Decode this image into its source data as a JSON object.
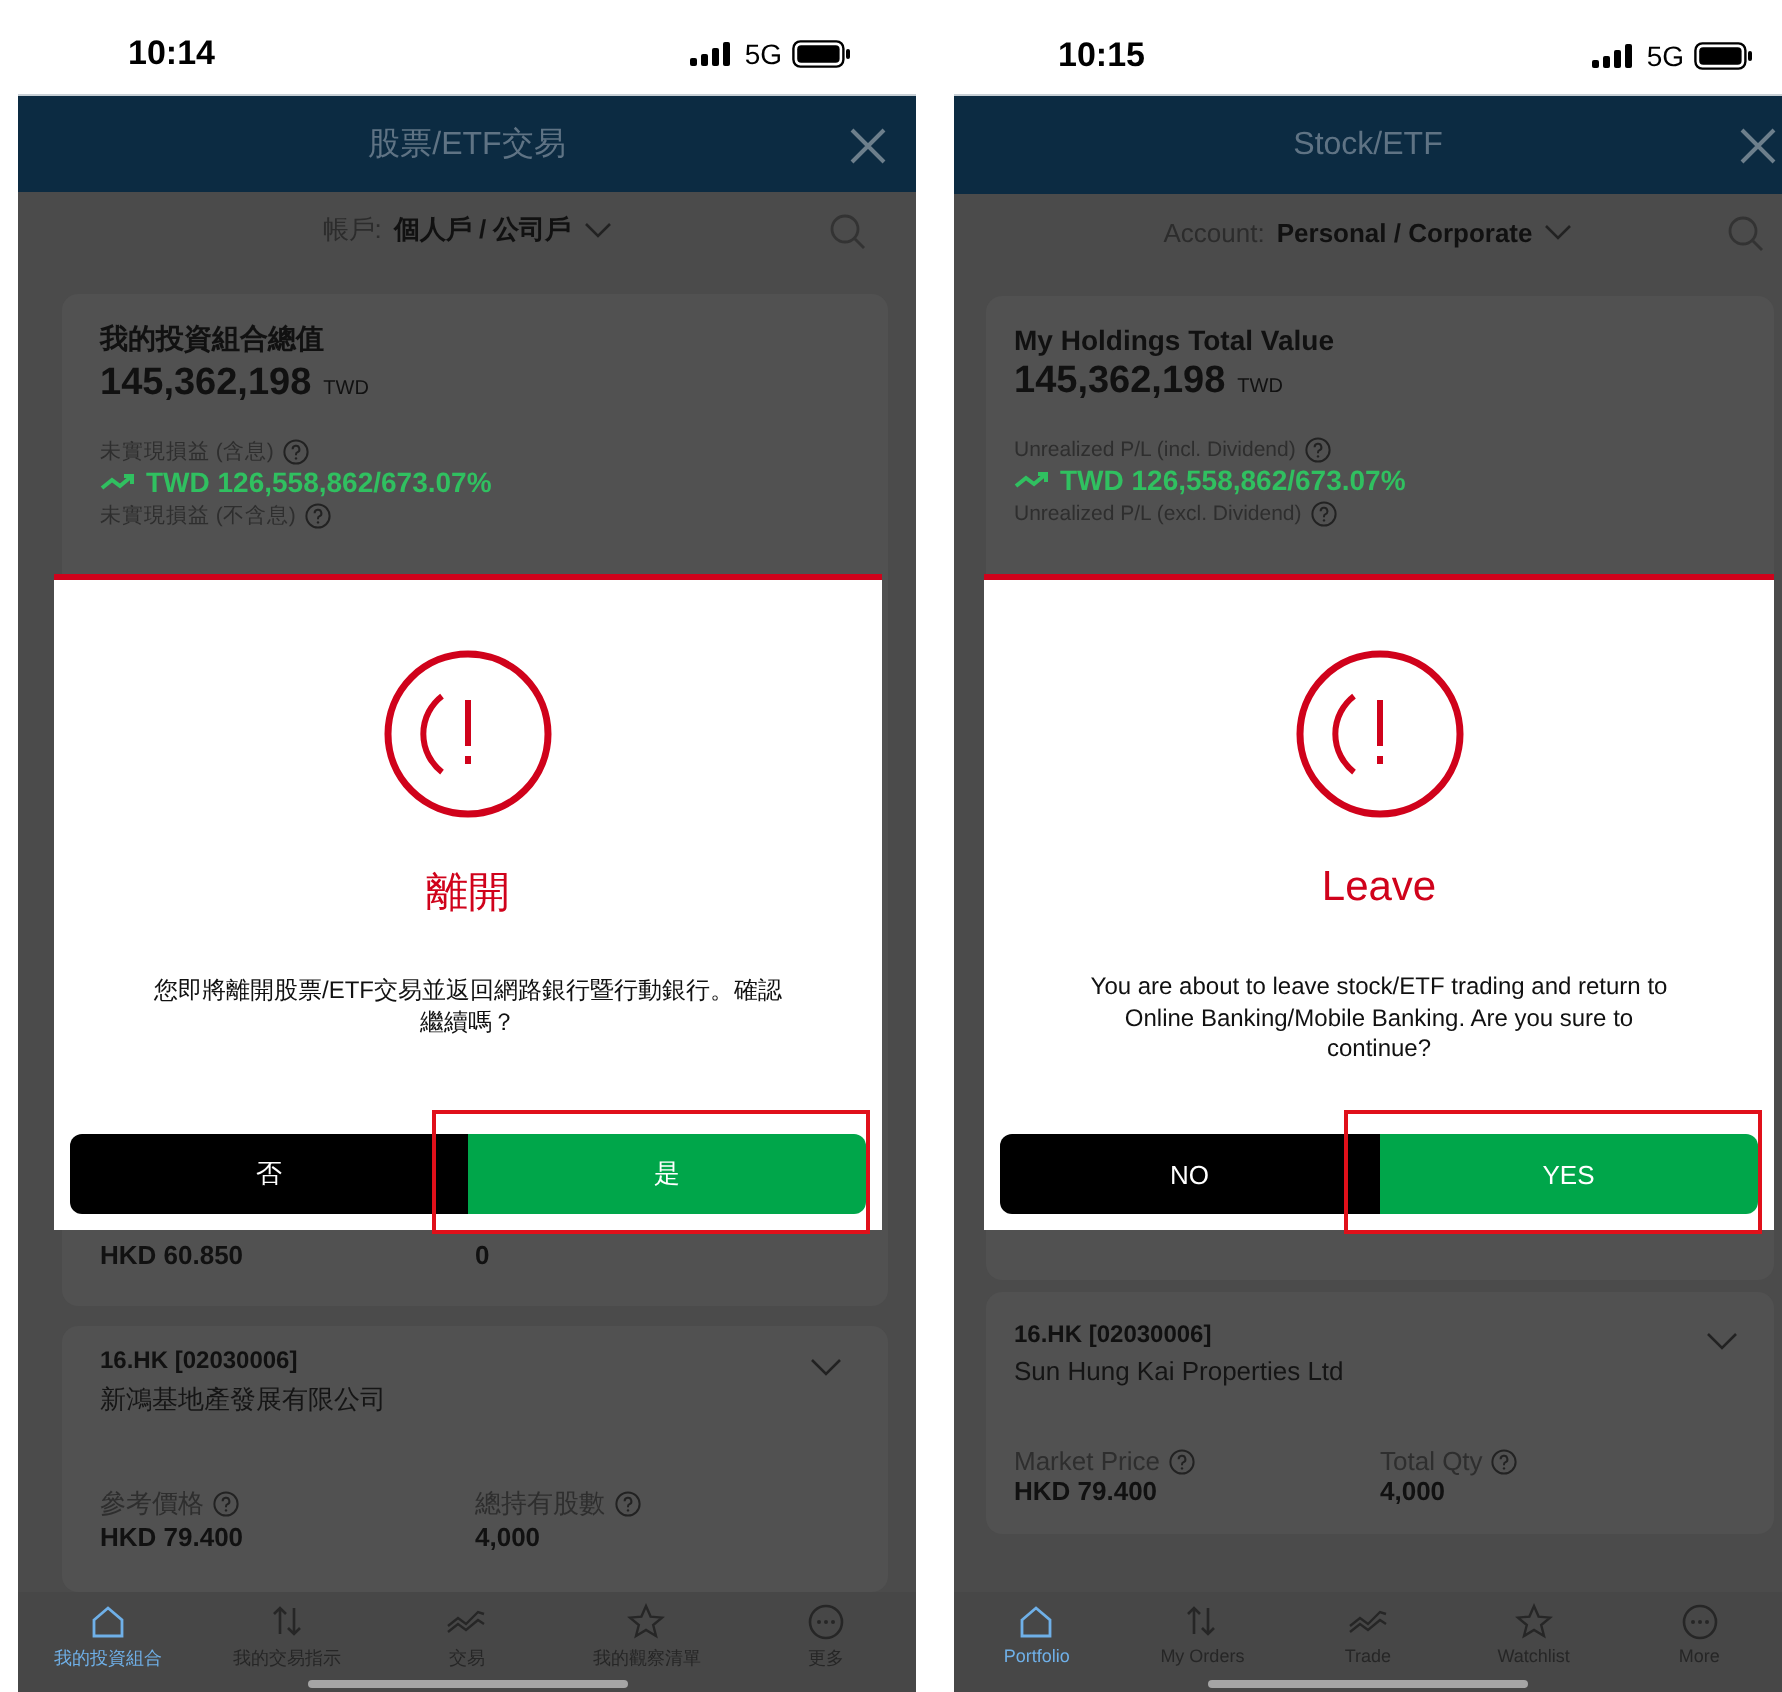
{
  "screens": [
    {
      "status_bar": {
        "time": "10:14",
        "network": "5G"
      },
      "header": {
        "title": "股票/ETF交易"
      },
      "account": {
        "label": "帳戶:",
        "value": "個人戶 / 公司戶"
      },
      "summary": {
        "title": "我的投資組合總值",
        "total": "145,362,198",
        "currency": "TWD",
        "pl_incl_label": "未實現損益 (含息)",
        "pl_incl_value": "TWD 126,558,862/673.07%",
        "pl_excl_label": "未實現損益 (不含息)"
      },
      "partial_holding": {
        "price": "HKD 60.850",
        "qty": "0"
      },
      "holdings": [
        {
          "code": "16.HK [02030006]",
          "name": "新鴻基地產發展有限公司",
          "price_label": "參考價格",
          "price": "HKD 79.400",
          "qty_label": "總持有股數",
          "qty": "4,000"
        }
      ],
      "dialog": {
        "title": "離開",
        "message": "您即將離開股票/ETF交易並返回網路銀行暨行動銀行。確認繼續嗎？",
        "buttons": [
          {
            "label": "否",
            "kind": "secondary",
            "highlighted": false
          },
          {
            "label": "是",
            "kind": "primary",
            "highlighted": true
          }
        ]
      },
      "nav": [
        {
          "label": "我的投資組合",
          "kind": "home",
          "selected": true
        },
        {
          "label": "我的交易指示",
          "kind": "orders",
          "selected": false
        },
        {
          "label": "交易",
          "kind": "trade",
          "selected": false
        },
        {
          "label": "我的觀察清單",
          "kind": "watchlist",
          "selected": false
        },
        {
          "label": "更多",
          "kind": "more",
          "selected": false
        }
      ]
    },
    {
      "status_bar": {
        "time": "10:15",
        "network": "5G"
      },
      "header": {
        "title": "Stock/ETF"
      },
      "account": {
        "label": "Account:",
        "value": "Personal / Corporate"
      },
      "summary": {
        "title": "My Holdings Total Value",
        "total": "145,362,198",
        "currency": "TWD",
        "pl_incl_label": "Unrealized P/L (incl. Dividend)",
        "pl_incl_value": "TWD 126,558,862/673.07%",
        "pl_excl_label": "Unrealized P/L (excl. Dividend)"
      },
      "holdings": [
        {
          "code": "16.HK [02030006]",
          "name": "Sun Hung Kai Properties Ltd",
          "price_label": "Market Price",
          "price": "HKD 79.400",
          "qty_label": "Total Qty",
          "qty": "4,000"
        }
      ],
      "dialog": {
        "title": "Leave",
        "message": "You are about to leave stock/ETF trading and return to Online Banking/Mobile Banking. Are you sure to continue?",
        "buttons": [
          {
            "label": "NO",
            "kind": "secondary",
            "highlighted": false
          },
          {
            "label": "YES",
            "kind": "primary",
            "highlighted": true
          }
        ]
      },
      "nav": [
        {
          "label": "Portfolio",
          "kind": "home",
          "selected": true
        },
        {
          "label": "My Orders",
          "kind": "orders",
          "selected": false
        },
        {
          "label": "Trade",
          "kind": "trade",
          "selected": false
        },
        {
          "label": "Watchlist",
          "kind": "watchlist",
          "selected": false
        },
        {
          "label": "More",
          "kind": "more",
          "selected": false
        }
      ]
    }
  ]
}
